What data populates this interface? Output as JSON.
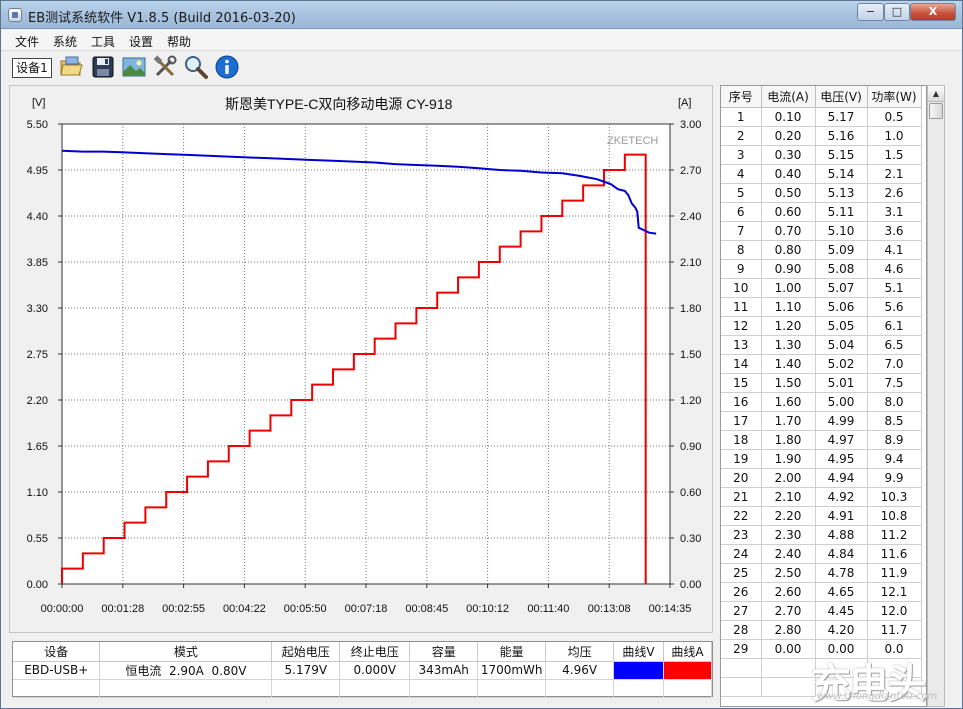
{
  "window": {
    "title": "EB测试系统软件 V1.8.5 (Build 2016-03-20)",
    "min_glyph": "−",
    "max_glyph": "□",
    "close_glyph": "X"
  },
  "menu": [
    "文件",
    "系统",
    "工具",
    "设置",
    "帮助"
  ],
  "toolbar": {
    "device_tab": "设备1",
    "icons": [
      "open-folder-icon",
      "save-disk-icon",
      "picture-icon",
      "tools-icon",
      "search-icon",
      "info-icon"
    ]
  },
  "chart_data": {
    "type": "line",
    "title": "斯恩美TYPE-C双向移动电源 CY-918",
    "watermark": "ZKETECH",
    "left_unit": "[V]",
    "right_unit": "[A]",
    "left_ylim": [
      0,
      5.5
    ],
    "right_ylim": [
      0,
      3.0
    ],
    "left_ticks": [
      "5.50",
      "4.95",
      "4.40",
      "3.85",
      "3.30",
      "2.75",
      "2.20",
      "1.65",
      "1.10",
      "0.55",
      "0.00"
    ],
    "right_ticks": [
      "3.00",
      "2.70",
      "2.40",
      "2.10",
      "1.80",
      "1.50",
      "1.20",
      "0.90",
      "0.60",
      "0.30",
      "0.00"
    ],
    "x_ticks": [
      "00:00:00",
      "00:01:28",
      "00:02:55",
      "00:04:22",
      "00:05:50",
      "00:07:18",
      "00:08:45",
      "00:10:12",
      "00:11:40",
      "00:13:08",
      "00:14:35"
    ],
    "xlim_seconds": [
      0,
      875
    ],
    "grid": true,
    "series": [
      {
        "axis": "left",
        "color": "#0000cc",
        "points": [
          [
            0,
            5.18
          ],
          [
            30,
            5.17
          ],
          [
            60,
            5.17
          ],
          [
            90,
            5.16
          ],
          [
            120,
            5.15
          ],
          [
            150,
            5.14
          ],
          [
            180,
            5.13
          ],
          [
            210,
            5.12
          ],
          [
            240,
            5.11
          ],
          [
            270,
            5.1
          ],
          [
            300,
            5.09
          ],
          [
            330,
            5.08
          ],
          [
            360,
            5.07
          ],
          [
            390,
            5.06
          ],
          [
            420,
            5.05
          ],
          [
            450,
            5.04
          ],
          [
            480,
            5.02
          ],
          [
            510,
            5.01
          ],
          [
            540,
            5.0
          ],
          [
            570,
            4.99
          ],
          [
            600,
            4.97
          ],
          [
            630,
            4.95
          ],
          [
            660,
            4.94
          ],
          [
            690,
            4.92
          ],
          [
            720,
            4.91
          ],
          [
            745,
            4.88
          ],
          [
            770,
            4.84
          ],
          [
            790,
            4.78
          ],
          [
            800,
            4.72
          ],
          [
            810,
            4.7
          ],
          [
            815,
            4.65
          ],
          [
            820,
            4.55
          ],
          [
            825,
            4.5
          ],
          [
            828,
            4.45
          ],
          [
            830,
            4.26
          ],
          [
            835,
            4.24
          ],
          [
            845,
            4.2
          ],
          [
            855,
            4.19
          ]
        ]
      },
      {
        "axis": "right",
        "color": "#ee0000",
        "start": 0.0,
        "step_seconds": 30,
        "step_currents": [
          0.1,
          0.2,
          0.3,
          0.4,
          0.5,
          0.6,
          0.7,
          0.8,
          0.9,
          1.0,
          1.1,
          1.2,
          1.3,
          1.4,
          1.5,
          1.6,
          1.7,
          1.8,
          1.9,
          2.0,
          2.1,
          2.2,
          2.3,
          2.4,
          2.5,
          2.6,
          2.7,
          2.8
        ],
        "end_value": 0.0
      }
    ]
  },
  "table": {
    "headers": [
      "序号",
      "电流(A)",
      "电压(V)",
      "功率(W)"
    ],
    "rows": [
      [
        "1",
        "0.10",
        "5.17",
        "0.5"
      ],
      [
        "2",
        "0.20",
        "5.16",
        "1.0"
      ],
      [
        "3",
        "0.30",
        "5.15",
        "1.5"
      ],
      [
        "4",
        "0.40",
        "5.14",
        "2.1"
      ],
      [
        "5",
        "0.50",
        "5.13",
        "2.6"
      ],
      [
        "6",
        "0.60",
        "5.11",
        "3.1"
      ],
      [
        "7",
        "0.70",
        "5.10",
        "3.6"
      ],
      [
        "8",
        "0.80",
        "5.09",
        "4.1"
      ],
      [
        "9",
        "0.90",
        "5.08",
        "4.6"
      ],
      [
        "10",
        "1.00",
        "5.07",
        "5.1"
      ],
      [
        "11",
        "1.10",
        "5.06",
        "5.6"
      ],
      [
        "12",
        "1.20",
        "5.05",
        "6.1"
      ],
      [
        "13",
        "1.30",
        "5.04",
        "6.5"
      ],
      [
        "14",
        "1.40",
        "5.02",
        "7.0"
      ],
      [
        "15",
        "1.50",
        "5.01",
        "7.5"
      ],
      [
        "16",
        "1.60",
        "5.00",
        "8.0"
      ],
      [
        "17",
        "1.70",
        "4.99",
        "8.5"
      ],
      [
        "18",
        "1.80",
        "4.97",
        "8.9"
      ],
      [
        "19",
        "1.90",
        "4.95",
        "9.4"
      ],
      [
        "20",
        "2.00",
        "4.94",
        "9.9"
      ],
      [
        "21",
        "2.10",
        "4.92",
        "10.3"
      ],
      [
        "22",
        "2.20",
        "4.91",
        "10.8"
      ],
      [
        "23",
        "2.30",
        "4.88",
        "11.2"
      ],
      [
        "24",
        "2.40",
        "4.84",
        "11.6"
      ],
      [
        "25",
        "2.50",
        "4.78",
        "11.9"
      ],
      [
        "26",
        "2.60",
        "4.65",
        "12.1"
      ],
      [
        "27",
        "2.70",
        "4.45",
        "12.0"
      ],
      [
        "28",
        "2.80",
        "4.20",
        "11.7"
      ],
      [
        "29",
        "0.00",
        "0.00",
        "0.0"
      ]
    ]
  },
  "summary": {
    "headers": [
      "设备",
      "模式",
      "起始电压",
      "终止电压",
      "容量",
      "能量",
      "均压",
      "曲线V",
      "曲线A"
    ],
    "row": [
      "EBD-USB+",
      "恒电流  2.90A  0.80V",
      "5.179V",
      "0.000V",
      "343mAh",
      "1700mWh",
      "4.96V"
    ],
    "curve_v_color": "#0000ff",
    "curve_a_color": "#ff0000"
  },
  "watermark": {
    "logo": "充电头",
    "url": "www.chongdiantou.com"
  }
}
